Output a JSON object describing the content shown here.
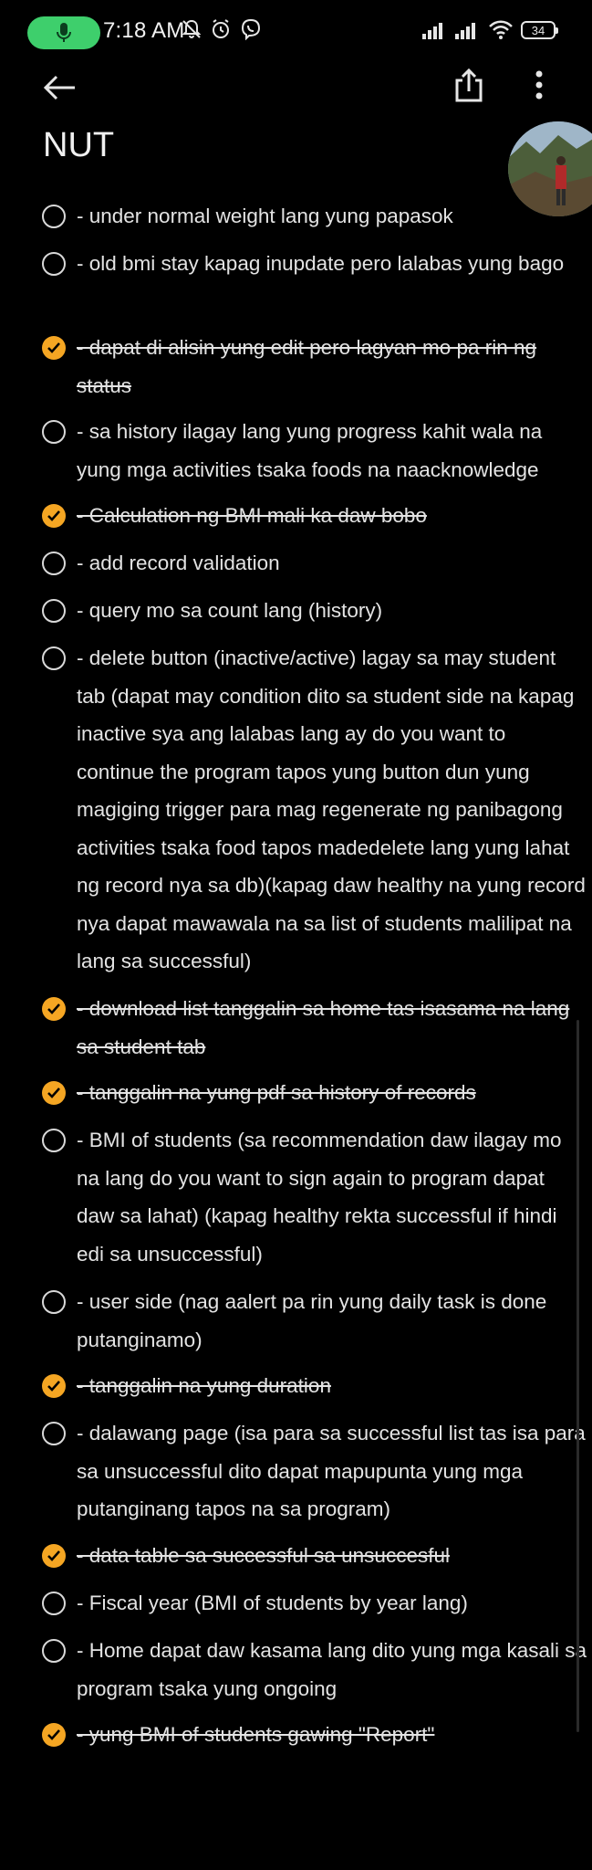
{
  "status_bar": {
    "time": "7:18 AM",
    "battery": "34",
    "icons": [
      "mic-icon",
      "mute-icon",
      "alarm-icon",
      "viber-icon",
      "signal-icon",
      "signal-icon",
      "wifi-icon",
      "battery-icon"
    ],
    "mic_pill_color": "#3ecf6c"
  },
  "app_bar": {
    "icons": [
      "back-arrow-icon",
      "share-icon",
      "more-vert-icon"
    ]
  },
  "note": {
    "title": "NUT",
    "accent_color": "#f5a623",
    "items": [
      {
        "text": "- under normal weight lang yung papasok",
        "done": false
      },
      {
        "text": "- old bmi stay kapag inupdate pero lalabas yung bago",
        "done": false
      },
      {
        "text": "- dapat di alisin yung edit pero lagyan mo pa rin ng status",
        "done": true
      },
      {
        "text": "- sa history ilagay lang yung progress kahit wala na yung mga activities tsaka foods na naacknowledge",
        "done": false
      },
      {
        "text": "- Calculation ng BMI mali ka daw bobo",
        "done": true
      },
      {
        "text": "- add record validation",
        "done": false
      },
      {
        "text": "- query mo sa count lang (history)",
        "done": false
      },
      {
        "text": "- delete button (inactive/active) lagay sa may student tab (dapat may condition dito sa student side na kapag inactive sya ang lalabas lang ay do you want to continue the program tapos yung button dun yung magiging trigger para mag regenerate ng panibagong activities tsaka food tapos madedelete lang yung lahat ng record nya sa db)(kapag daw healthy na yung record nya dapat mawawala na sa list of students malilipat na lang sa successful)",
        "done": false
      },
      {
        "text": "- download list tanggalin sa home tas isasama na lang sa student tab",
        "done": true
      },
      {
        "text": "- tanggalin na yung pdf sa history of records",
        "done": true
      },
      {
        "text": "- BMI of students (sa recommendation daw ilagay mo na lang do you want to sign again to program dapat daw sa lahat) (kapag healthy rekta successful if hindi edi sa unsuccessful)",
        "done": false
      },
      {
        "text": "- user side (nag aalert pa rin yung daily task is done putanginamo)",
        "done": false
      },
      {
        "text": "- tanggalin na yung duration",
        "done": true
      },
      {
        "text": "- dalawang page (isa para sa successful list tas isa para sa unsuccessful dito dapat mapupunta yung mga putanginang tapos na sa program)",
        "done": false
      },
      {
        "text": "- data table sa successful sa unsuccesful",
        "done": true
      },
      {
        "text": "- Fiscal year (BMI of students by year lang)",
        "done": false
      },
      {
        "text": "- Home dapat daw kasama lang dito yung mga kasali sa program tsaka yung ongoing",
        "done": false
      },
      {
        "text": "- yung BMI of students gawing \"Report\"",
        "done": true
      }
    ]
  }
}
